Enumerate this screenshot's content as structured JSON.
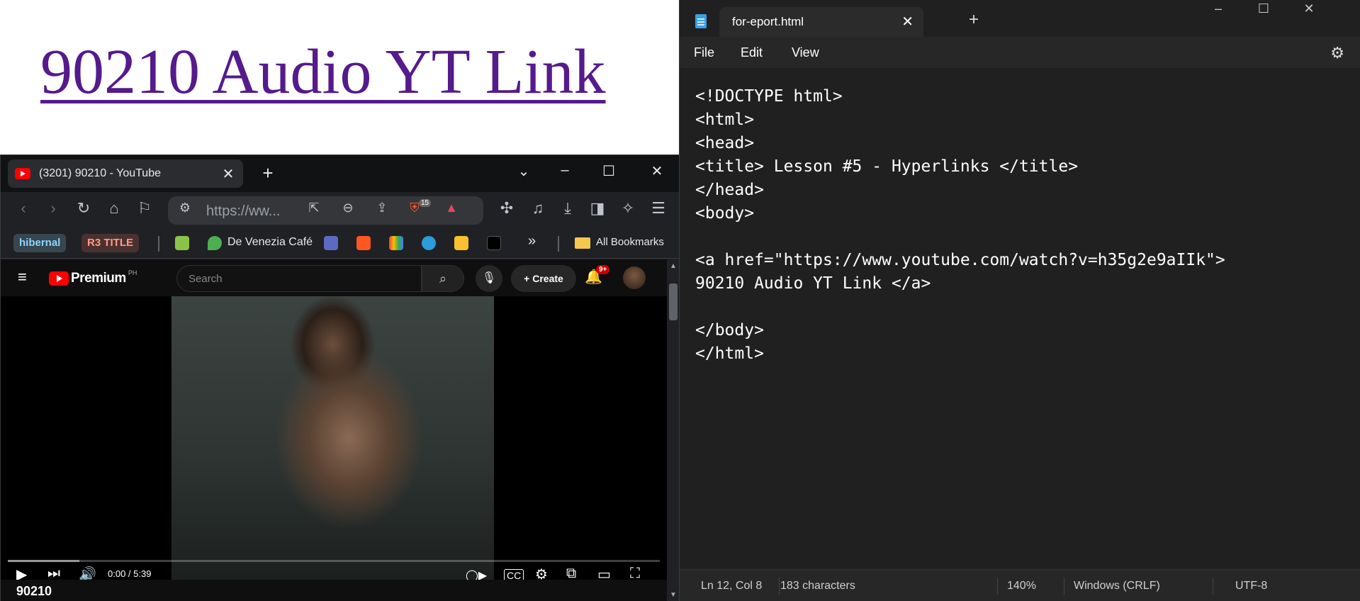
{
  "background_page": {
    "link_text": "90210 Audio YT Link"
  },
  "browser": {
    "tab_title": "(3201) 90210 - YouTube",
    "url_display": "https://ww...",
    "brave_shield_count": "15",
    "bookmarks": {
      "chip1": "hibernal",
      "chip2": "R3 TITLE",
      "venezia": "De Venezia Café",
      "all": "All Bookmarks"
    },
    "colors": {
      "chip1_bg": "#37474f",
      "chip1_fg": "#8fd3ff",
      "chip2_bg": "#4a3130",
      "chip2_fg": "#ff9a8a"
    }
  },
  "youtube": {
    "brand": "Premium",
    "region": "PH",
    "search_placeholder": "Search",
    "create_label": "Create",
    "notif_badge": "9+",
    "time": "0:00 / 5:39",
    "buffered_fraction": 0.11,
    "video_title": "90210"
  },
  "notepad": {
    "tab_title": "for-eport.html",
    "menu": {
      "file": "File",
      "edit": "Edit",
      "view": "View"
    },
    "code": "<!DOCTYPE html>\n<html>\n<head>\n<title> Lesson #5 - Hyperlinks </title>\n</head>\n<body>\n\n<a href=\"https://www.youtube.com/watch?v=h35g2e9aIIk\">\n90210 Audio YT Link </a>\n\n</body>\n</html>",
    "status": {
      "position": "Ln 12, Col 8",
      "characters": "183 characters",
      "zoom": "140%",
      "line_ending": "Windows (CRLF)",
      "encoding": "UTF-8"
    }
  }
}
